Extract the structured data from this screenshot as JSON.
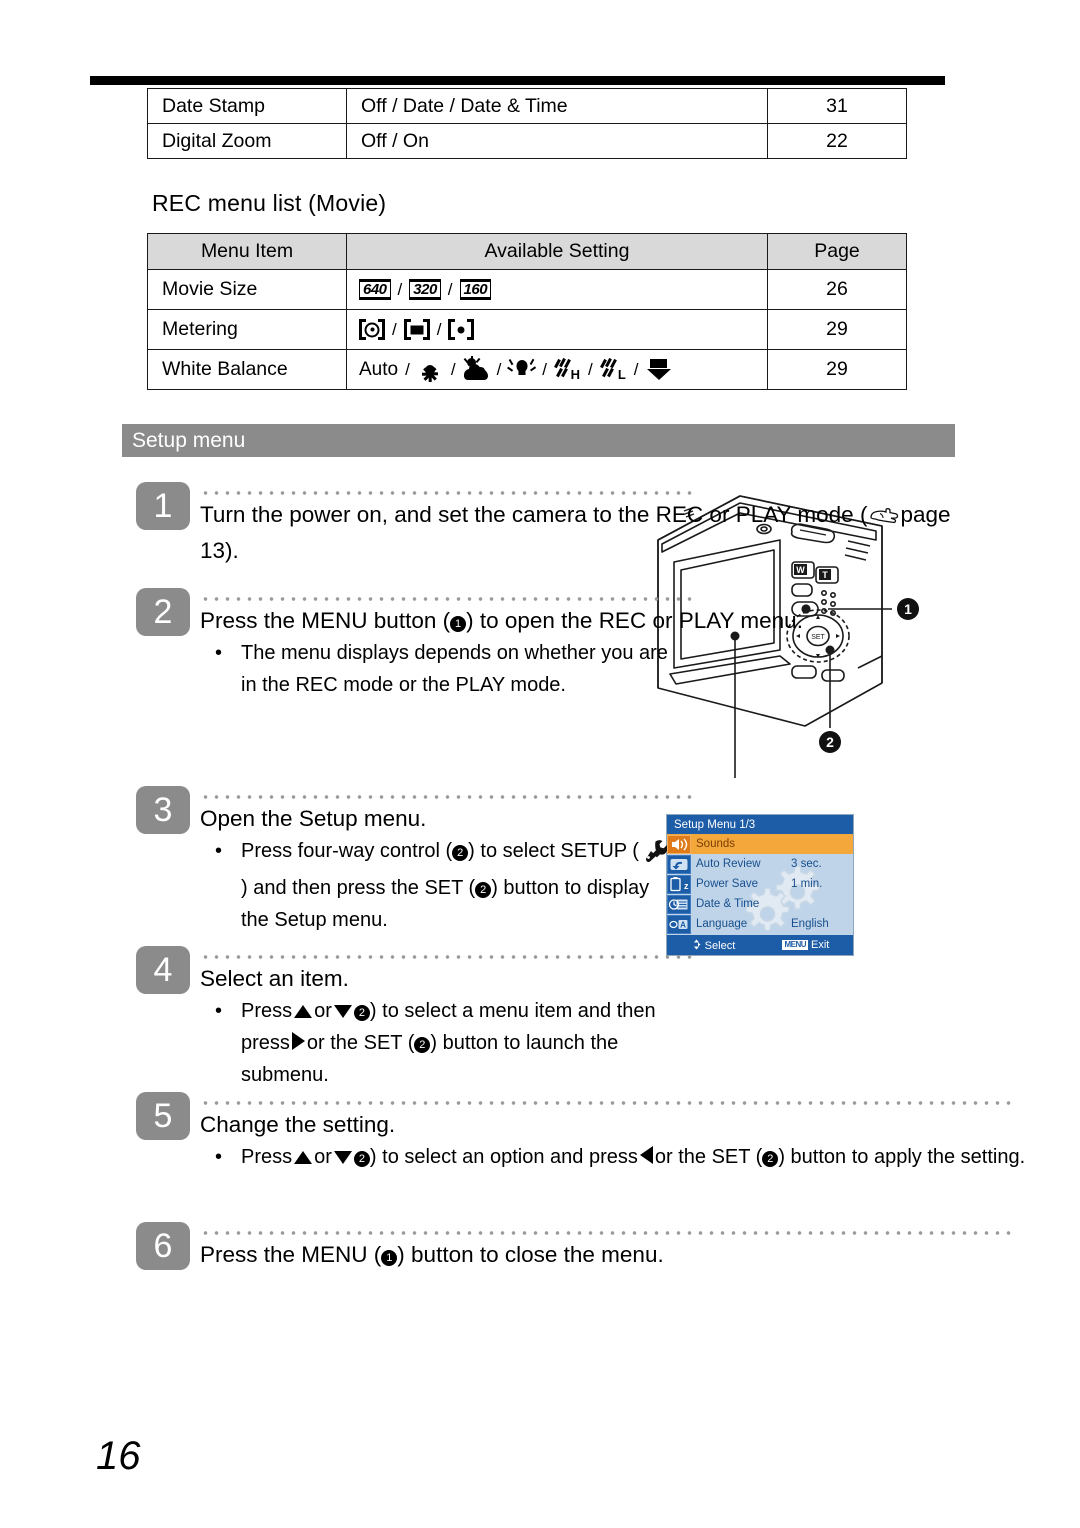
{
  "page": {
    "number": "16"
  },
  "table_continued": {
    "rows": [
      {
        "item": "Date Stamp",
        "setting": "Off / Date / Date & Time",
        "page": "31"
      },
      {
        "item": "Digital Zoom",
        "setting": "Off / On",
        "page": "22"
      }
    ]
  },
  "rec_movie": {
    "caption": "REC menu list (Movie)",
    "headers": {
      "item": "Menu Item",
      "setting": "Available Setting",
      "page": "Page"
    },
    "rows": [
      {
        "item": "Movie Size",
        "page": "26",
        "icons": [
          "640",
          "320",
          "160"
        ],
        "icon_names": [
          "movie-size-640-icon",
          "movie-size-320-icon",
          "movie-size-160-icon"
        ]
      },
      {
        "item": "Metering",
        "page": "29",
        "icon_names": [
          "metering-multi-icon",
          "metering-center-icon",
          "metering-spot-icon"
        ]
      },
      {
        "item": "White Balance",
        "page": "29",
        "auto_label": "Auto",
        "icon_names": [
          "wb-daylight-icon",
          "wb-cloudy-icon",
          "wb-tungsten-icon",
          "wb-fluorescent-h-icon",
          "wb-fluorescent-l-icon",
          "wb-custom-icon"
        ],
        "fluorescent_h": "H",
        "fluorescent_l": "L"
      }
    ]
  },
  "setup_section": {
    "title": "Setup menu"
  },
  "steps": [
    {
      "number": "1",
      "title_a": "Turn the power on, and set the camera to the REC or PLAY mode (",
      "title_b": "page 13).",
      "bullets": []
    },
    {
      "number": "2",
      "title_a": "Press the MENU button (",
      "title_mid": ") to open the REC or PLAY menu.",
      "callout": "1",
      "bullets": [
        "The menu displays depends on whether you are in the REC mode or the PLAY mode."
      ]
    },
    {
      "number": "3",
      "title": "Open the Setup menu.",
      "bullet_a": "Press four-way control (",
      "bullet_callout1": "2",
      "bullet_b": ") to select SETUP (",
      "bullet_c": ") and then press the SET (",
      "bullet_callout2": "2",
      "bullet_d": ") button to display the Setup menu."
    },
    {
      "number": "4",
      "title": "Select an item.",
      "bullet_a": "Press",
      "bullet_b": "or",
      "bullet_c": ")  to select a menu item and then press",
      "bullet_d": "or the SET (",
      "bullet_e": ") button to launch the submenu.",
      "callout1": "2",
      "callout2": "2"
    },
    {
      "number": "5",
      "title": "Change the setting.",
      "bullet_a": "Press",
      "bullet_b": "or",
      "bullet_c": ") to select an option and press",
      "bullet_d": "or the SET (",
      "bullet_e": ") button to apply the setting.",
      "callout1": "2",
      "callout2": "2"
    },
    {
      "number": "6",
      "title_a": "Press the MENU (",
      "callout": "1",
      "title_b": ") button to close the menu."
    }
  ],
  "camera": {
    "callout_1": "1",
    "callout_2": "2",
    "zoom_wide_label": "W",
    "zoom_tele_label": "T",
    "set_label": "SET"
  },
  "lcd_menu": {
    "title": "Setup Menu 1/3",
    "rows": [
      {
        "label": "Sounds",
        "value": "",
        "selected": true,
        "icon": "speaker-icon"
      },
      {
        "label": "Auto Review",
        "value": "3 sec.",
        "selected": false,
        "icon": "review-arrow-icon"
      },
      {
        "label": "Power Save",
        "value": "1 min.",
        "selected": false,
        "icon": "battery-sleep-icon"
      },
      {
        "label": "Date & Time",
        "value": "",
        "selected": false,
        "icon": "calendar-icon"
      },
      {
        "label": "Language",
        "value": "English",
        "selected": false,
        "icon": "language-icon"
      }
    ],
    "footer": {
      "select_label": "Select",
      "menu_chip": "MENU",
      "exit_label": "Exit"
    }
  },
  "colors": {
    "section_bar": "#8b8b8b",
    "step_badge": "#8b8b8b",
    "table_header": "#d9d9d9",
    "lcd_title": "#1d5ca6",
    "lcd_selected": "#f4a83c",
    "lcd_background": "#bfd4e8"
  }
}
